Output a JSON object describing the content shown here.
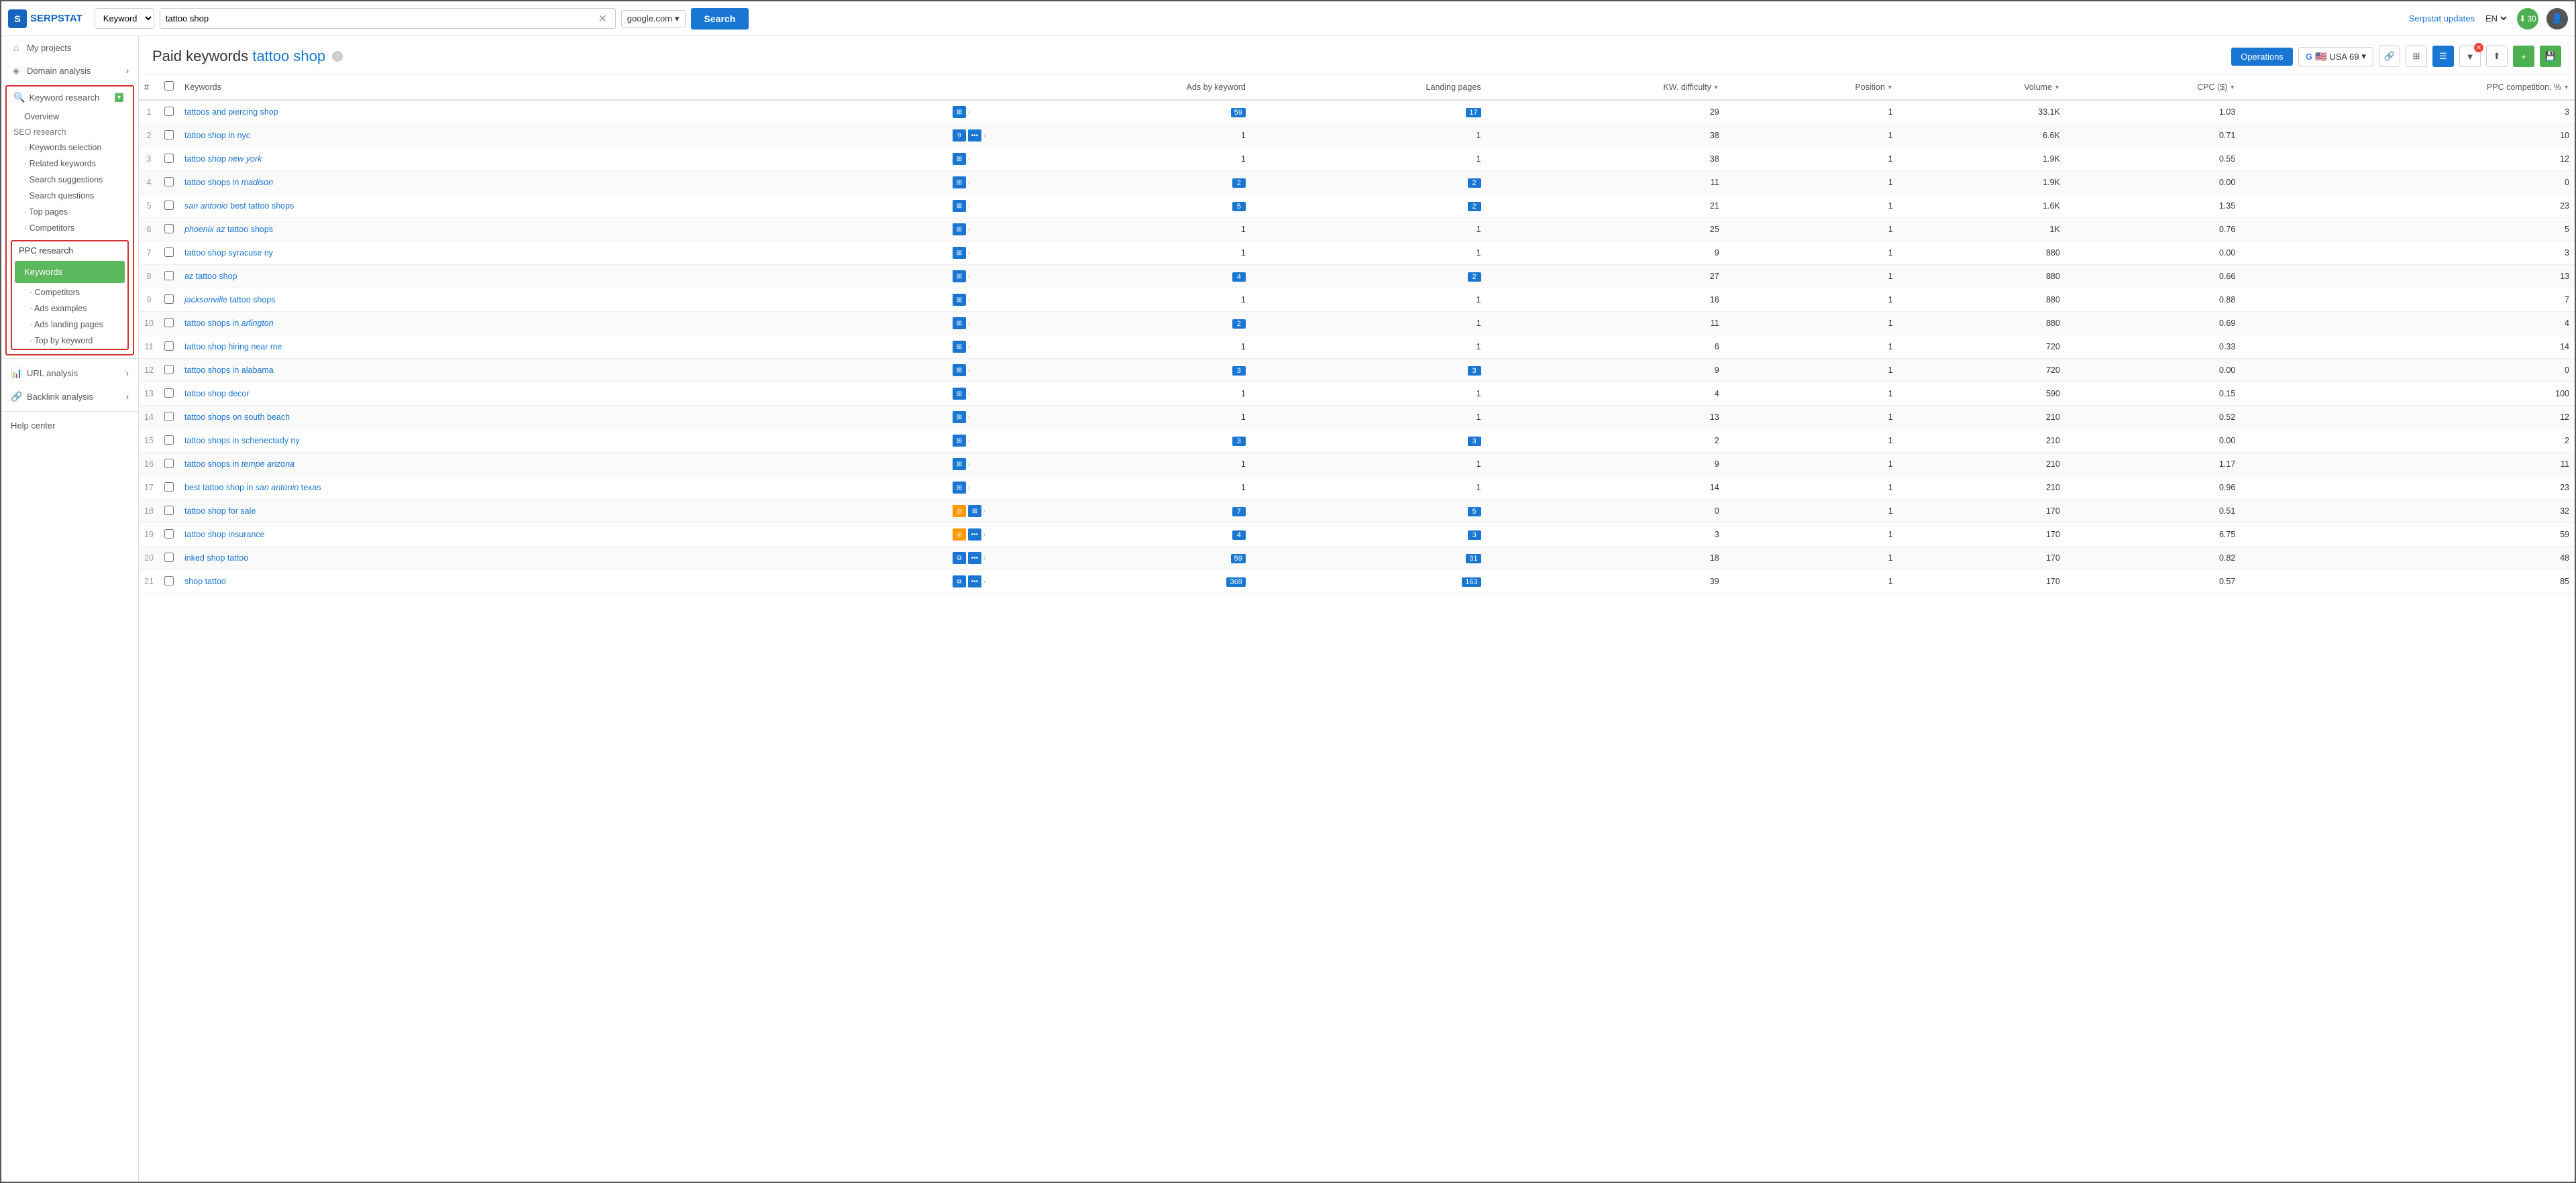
{
  "topbar": {
    "logo_text": "SERPSTAT",
    "keyword_select_value": "Keyword",
    "search_input_value": "tattoo shop",
    "engine_value": "google.com",
    "search_button_label": "Search",
    "serpstat_updates_label": "Serpstat updates",
    "lang_label": "EN",
    "download_count": "30"
  },
  "sidebar": {
    "my_projects_label": "My projects",
    "domain_analysis_label": "Domain analysis",
    "keyword_research_label": "Keyword research",
    "overview_label": "Overview",
    "seo_research_label": "SEO research",
    "keywords_selection_label": "Keywords selection",
    "related_keywords_label": "Related keywords",
    "search_suggestions_label": "Search suggestions",
    "search_questions_label": "Search questions",
    "top_pages_label": "Top pages",
    "competitors_seo_label": "Competitors",
    "ppc_research_label": "PPC research",
    "keywords_label": "Keywords",
    "competitors_ppc_label": "Competitors",
    "ads_examples_label": "Ads examples",
    "ads_landing_pages_label": "Ads landing pages",
    "top_by_keyword_label": "Top by keyword",
    "url_analysis_label": "URL analysis",
    "backlink_analysis_label": "Backlink analysis",
    "help_center_label": "Help center"
  },
  "content": {
    "page_title_static": "Paid keywords",
    "page_title_highlight": "tattoo shop",
    "operations_btn": "Operations",
    "google_flag_label": "USA 69",
    "columns": [
      "#",
      "",
      "Keywords",
      "",
      "Ads by keyword",
      "Landing pages",
      "KW. difficulty",
      "Position",
      "Volume",
      "CPC ($)",
      "PPC competition, %"
    ],
    "rows": [
      {
        "num": 1,
        "keyword": "tattoos and piercing shop",
        "keyword_html": "tattoos and piercing shop",
        "icons": [
          "grid",
          "arrow"
        ],
        "ads": "59",
        "landing": "17",
        "kw_diff": "29",
        "position": "1",
        "volume": "33.1K",
        "cpc": "1.03",
        "ppc": "3"
      },
      {
        "num": 2,
        "keyword": "tattoo shop in nyc",
        "keyword_html": "tattoo shop in nyc",
        "icons": [
          "num9",
          "dots",
          "arrow"
        ],
        "ads": "1",
        "landing": "1",
        "kw_diff": "38",
        "position": "1",
        "volume": "6.6K",
        "cpc": "0.71",
        "ppc": "10"
      },
      {
        "num": 3,
        "keyword": "tattoo shop new york",
        "keyword_html": "tattoo shop <em>new york</em>",
        "icons": [
          "grid",
          "arrow"
        ],
        "ads": "1",
        "landing": "1",
        "kw_diff": "38",
        "position": "1",
        "volume": "1.9K",
        "cpc": "0.55",
        "ppc": "12"
      },
      {
        "num": 4,
        "keyword": "tattoo shops in madison",
        "keyword_html": "tattoo shops in <em>madison</em>",
        "icons": [
          "grid",
          "arrow"
        ],
        "ads": "2",
        "landing": "2",
        "kw_diff": "11",
        "position": "1",
        "volume": "1.9K",
        "cpc": "0.00",
        "ppc": "0"
      },
      {
        "num": 5,
        "keyword": "san antonio best tattoo shops",
        "keyword_html": "<em>san antonio</em> best tattoo shops",
        "icons": [
          "grid",
          "arrow"
        ],
        "ads": "5",
        "landing": "2",
        "kw_diff": "21",
        "position": "1",
        "volume": "1.6K",
        "cpc": "1.35",
        "ppc": "23"
      },
      {
        "num": 6,
        "keyword": "phoenix az tattoo shops",
        "keyword_html": "<em>phoenix az</em> tattoo shops",
        "icons": [
          "grid",
          "arrow"
        ],
        "ads": "1",
        "landing": "1",
        "kw_diff": "25",
        "position": "1",
        "volume": "1K",
        "cpc": "0.76",
        "ppc": "5"
      },
      {
        "num": 7,
        "keyword": "tattoo shop syracuse ny",
        "keyword_html": "tattoo shop syracuse ny",
        "icons": [
          "grid",
          "arrow"
        ],
        "ads": "1",
        "landing": "1",
        "kw_diff": "9",
        "position": "1",
        "volume": "880",
        "cpc": "0.00",
        "ppc": "3"
      },
      {
        "num": 8,
        "keyword": "az tattoo shop",
        "keyword_html": "az tattoo shop",
        "icons": [
          "grid",
          "arrow"
        ],
        "ads": "4",
        "landing": "2",
        "kw_diff": "27",
        "position": "1",
        "volume": "880",
        "cpc": "0.66",
        "ppc": "13"
      },
      {
        "num": 9,
        "keyword": "jacksonville tattoo shops",
        "keyword_html": "<em>jacksonville</em> tattoo shops",
        "icons": [
          "grid",
          "arrow"
        ],
        "ads": "1",
        "landing": "1",
        "kw_diff": "16",
        "position": "1",
        "volume": "880",
        "cpc": "0.88",
        "ppc": "7"
      },
      {
        "num": 10,
        "keyword": "tattoo shops in arlington",
        "keyword_html": "tattoo shops in <em>arlington</em>",
        "icons": [
          "grid",
          "arrow"
        ],
        "ads": "2",
        "landing": "1",
        "kw_diff": "11",
        "position": "1",
        "volume": "880",
        "cpc": "0.69",
        "ppc": "4"
      },
      {
        "num": 11,
        "keyword": "tattoo shop hiring near me",
        "keyword_html": "tattoo shop hiring near me",
        "icons": [
          "grid",
          "arrow"
        ],
        "ads": "1",
        "landing": "1",
        "kw_diff": "6",
        "position": "1",
        "volume": "720",
        "cpc": "0.33",
        "ppc": "14"
      },
      {
        "num": 12,
        "keyword": "tattoo shops in alabama",
        "keyword_html": "tattoo shops in alabama",
        "icons": [
          "grid",
          "arrow"
        ],
        "ads": "3",
        "landing": "3",
        "kw_diff": "9",
        "position": "1",
        "volume": "720",
        "cpc": "0.00",
        "ppc": "0"
      },
      {
        "num": 13,
        "keyword": "tattoo shop decor",
        "keyword_html": "tattoo shop decor",
        "icons": [
          "grid",
          "arrow"
        ],
        "ads": "1",
        "landing": "1",
        "kw_diff": "4",
        "position": "1",
        "volume": "590",
        "cpc": "0.15",
        "ppc": "100"
      },
      {
        "num": 14,
        "keyword": "tattoo shops on south beach",
        "keyword_html": "tattoo shops on south beach",
        "icons": [
          "grid",
          "arrow"
        ],
        "ads": "1",
        "landing": "1",
        "kw_diff": "13",
        "position": "1",
        "volume": "210",
        "cpc": "0.52",
        "ppc": "12"
      },
      {
        "num": 15,
        "keyword": "tattoo shops in schenectady ny",
        "keyword_html": "tattoo shops in schenectady ny",
        "icons": [
          "grid",
          "arrow"
        ],
        "ads": "3",
        "landing": "3",
        "kw_diff": "2",
        "position": "1",
        "volume": "210",
        "cpc": "0.00",
        "ppc": "2"
      },
      {
        "num": 16,
        "keyword": "tattoo shops in tempe arizona",
        "keyword_html": "tattoo shops in <em>tempe arizona</em>",
        "icons": [
          "grid",
          "arrow"
        ],
        "ads": "1",
        "landing": "1",
        "kw_diff": "9",
        "position": "1",
        "volume": "210",
        "cpc": "1.17",
        "ppc": "11"
      },
      {
        "num": 17,
        "keyword": "best tattoo shop in san antonio texas",
        "keyword_html": "best tattoo shop in <em>san antonio</em> texas",
        "icons": [
          "grid",
          "arrow"
        ],
        "ads": "1",
        "landing": "1",
        "kw_diff": "14",
        "position": "1",
        "volume": "210",
        "cpc": "0.96",
        "ppc": "23"
      },
      {
        "num": 18,
        "keyword": "tattoo shop for sale",
        "keyword_html": "tattoo shop for sale",
        "icons": [
          "orange",
          "grid",
          "arrow"
        ],
        "ads": "7",
        "landing": "5",
        "kw_diff": "0",
        "position": "1",
        "volume": "170",
        "cpc": "0.51",
        "ppc": "32"
      },
      {
        "num": 19,
        "keyword": "tattoo shop insurance",
        "keyword_html": "tattoo shop insurance",
        "icons": [
          "orange",
          "dots",
          "arrow"
        ],
        "ads": "4",
        "landing": "3",
        "kw_diff": "3",
        "position": "1",
        "volume": "170",
        "cpc": "6.75",
        "ppc": "59"
      },
      {
        "num": 20,
        "keyword": "inked shop tattoo",
        "keyword_html": "inked shop tattoo",
        "icons": [
          "copy",
          "dots",
          "arrow"
        ],
        "ads": "59",
        "landing": "31",
        "kw_diff": "18",
        "position": "1",
        "volume": "170",
        "cpc": "0.82",
        "ppc": "48"
      },
      {
        "num": 21,
        "keyword": "shop tattoo",
        "keyword_html": "shop tattoo",
        "icons": [
          "copy",
          "dots",
          "arrow"
        ],
        "ads": "369",
        "landing": "163",
        "kw_diff": "39",
        "position": "1",
        "volume": "170",
        "cpc": "0.57",
        "ppc": "85"
      }
    ]
  }
}
